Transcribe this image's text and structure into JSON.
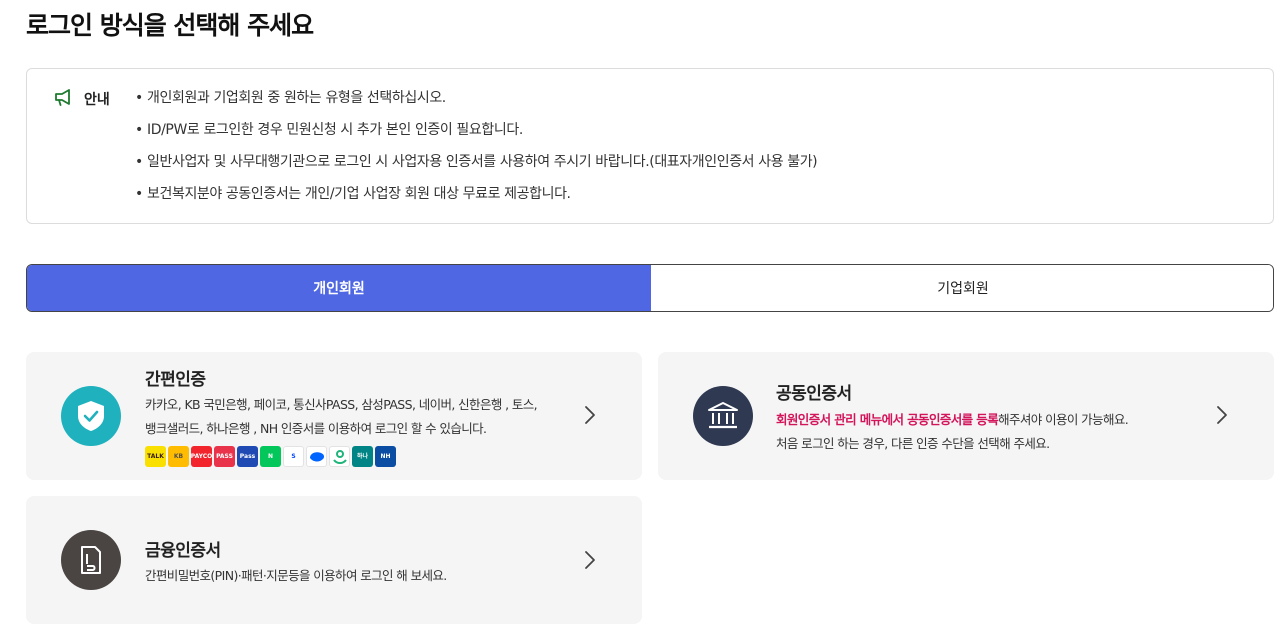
{
  "page": {
    "title": "로그인 방식을 선택해 주세요"
  },
  "notice": {
    "label": "안내",
    "items": [
      "개인회원과 기업회원 중 원하는 유형을 선택하십시오.",
      "ID/PW로 로그인한 경우 민원신청 시 추가 본인 인증이 필요합니다.",
      "일반사업자 및 사무대행기관으로 로그인 시 사업자용 인증서를 사용하여 주시기 바랍니다.(대표자개인인증서 사용 불가)",
      "보건복지분야 공동인증서는 개인/기업 사업장 회원 대상 무료로 제공합니다."
    ]
  },
  "tabs": [
    {
      "label": "개인회원",
      "active": true
    },
    {
      "label": "기업회원",
      "active": false
    }
  ],
  "cards": {
    "simple": {
      "title": "간편인증",
      "desc_line1": "카카오, KB 국민은행, 페이코, 통신사PASS, 삼성PASS, 네이버, 신한은행 , 토스,",
      "desc_line2": "뱅크샐러드, 하나은행 , NH 인증서를 이용하여 로그인 할 수 있습니다.",
      "providers": [
        {
          "name": "kakao",
          "text": "TALK",
          "bg": "#f9e000",
          "fg": "#3a1d1d"
        },
        {
          "name": "kb",
          "text": "KB",
          "bg": "#ffbc00",
          "fg": "#54504a"
        },
        {
          "name": "payco",
          "text": "PAYCO",
          "bg": "#f2242c",
          "fg": "#ffffff"
        },
        {
          "name": "pass",
          "text": "PASS",
          "bg": "#e9334b",
          "fg": "#ffffff"
        },
        {
          "name": "samsung-pass",
          "text": "Pass",
          "bg": "#1f4ab4",
          "fg": "#ffffff"
        },
        {
          "name": "naver",
          "text": "N",
          "bg": "#03c75a",
          "fg": "#ffffff"
        },
        {
          "name": "shinhan",
          "text": "S",
          "bg": "#ffffff",
          "fg": "#0046ff"
        },
        {
          "name": "toss",
          "text": "",
          "bg": "#ffffff",
          "fg": "#0064ff"
        },
        {
          "name": "banksalad",
          "text": "",
          "bg": "#ffffff",
          "fg": "#1fb57a"
        },
        {
          "name": "hana",
          "text": "하나",
          "bg": "#008485",
          "fg": "#ffffff"
        },
        {
          "name": "nh",
          "text": "NH",
          "bg": "#0a4da2",
          "fg": "#ffffff"
        }
      ]
    },
    "joint": {
      "title": "공동인증서",
      "highlight": "회원인증서 관리 메뉴에서 공동인증서를 등록",
      "desc_line1_rest": "해주셔야 이용이 가능해요.",
      "desc_line2": "처음 로그인 하는 경우, 다른 인증 수단을 선택해 주세요."
    },
    "financial": {
      "title": "금융인증서",
      "desc": "간편비밀번호(PIN)·패턴·지문등을 이용하여 로그인 해 보세요."
    }
  },
  "colors": {
    "accent": "#4f67e2",
    "simple_icon": "#1fb1bd",
    "joint_icon": "#2f3a52",
    "financial_icon": "#4a4543",
    "highlight": "#d4145a",
    "notice_icon": "#1e7a2e"
  }
}
